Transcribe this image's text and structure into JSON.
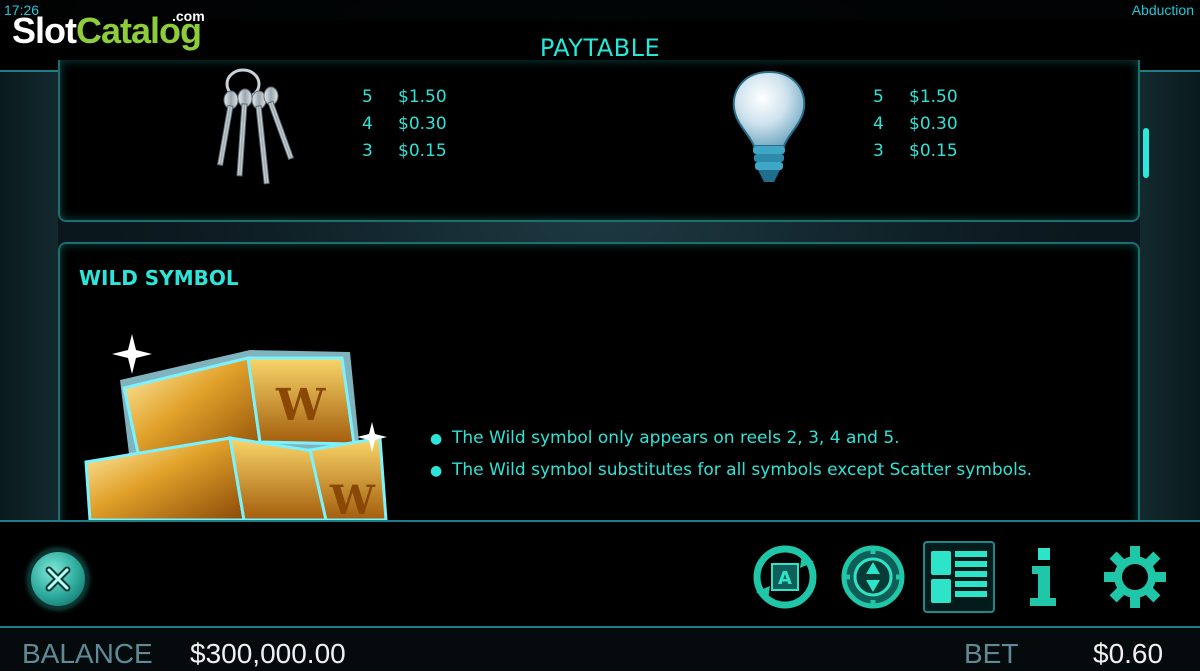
{
  "status_bar": {
    "time": "17:26",
    "game_name": "Abduction"
  },
  "watermark": {
    "slot": "Slot",
    "catalog": "Catalog",
    "com": ".com"
  },
  "header": {
    "title": "PAYTABLE"
  },
  "paytable": {
    "symbols": [
      {
        "icon": "keys-icon",
        "pays": [
          {
            "count": "5",
            "amount": "$1.50"
          },
          {
            "count": "4",
            "amount": "$0.30"
          },
          {
            "count": "3",
            "amount": "$0.15"
          }
        ]
      },
      {
        "icon": "lightbulb-icon",
        "pays": [
          {
            "count": "5",
            "amount": "$1.50"
          },
          {
            "count": "4",
            "amount": "$0.30"
          },
          {
            "count": "3",
            "amount": "$0.15"
          }
        ]
      }
    ]
  },
  "wild": {
    "title": "WILD SYMBOL",
    "icon": "gold-bars-wild-icon",
    "bullets": [
      "The Wild symbol only appears on reels 2, 3, 4 and 5.",
      "The Wild symbol substitutes for all symbols except Scatter symbols."
    ]
  },
  "controls": {
    "close": "close-icon",
    "autoplay": "autoplay-icon",
    "bet": "bet-chip-icon",
    "paytable": "paytable-icon",
    "info": "info-icon",
    "settings": "gear-icon"
  },
  "footer": {
    "balance_label": "BALANCE",
    "balance_value": "$300,000.00",
    "bet_label": "BET",
    "bet_value": "$0.60"
  },
  "colors": {
    "accent": "#2ee4d8",
    "border": "#1a7f86",
    "background": "#000000"
  }
}
